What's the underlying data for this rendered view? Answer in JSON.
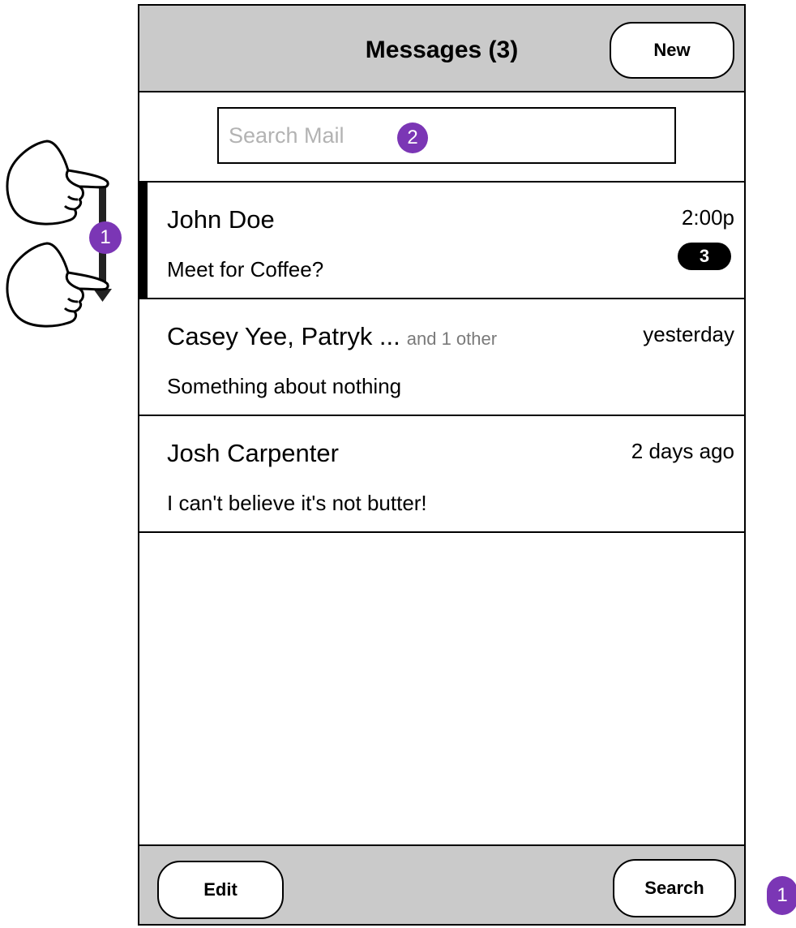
{
  "header": {
    "title": "Messages (3)",
    "new_label": "New"
  },
  "search": {
    "placeholder": "Search Mail",
    "marker": "2"
  },
  "messages": [
    {
      "sender": "John Doe",
      "extra": "",
      "preview": "Meet for Coffee?",
      "time": "2:00p",
      "badge": "3"
    },
    {
      "sender": "Casey Yee, Patryk ...",
      "extra": "and 1 other",
      "preview": "Something about nothing",
      "time": "yesterday"
    },
    {
      "sender": "Josh Carpenter",
      "extra": "",
      "preview": "I can't believe it's not butter!",
      "time": "2 days ago"
    }
  ],
  "footer": {
    "edit_label": "Edit",
    "search_label": "Search"
  },
  "annotations": {
    "gesture_marker": "1",
    "footer_marker": "1"
  },
  "colors": {
    "marker": "#7b36b5",
    "bar": "#cacaca"
  },
  "icons": {
    "gesture": "swipe-down-hand-icon"
  }
}
